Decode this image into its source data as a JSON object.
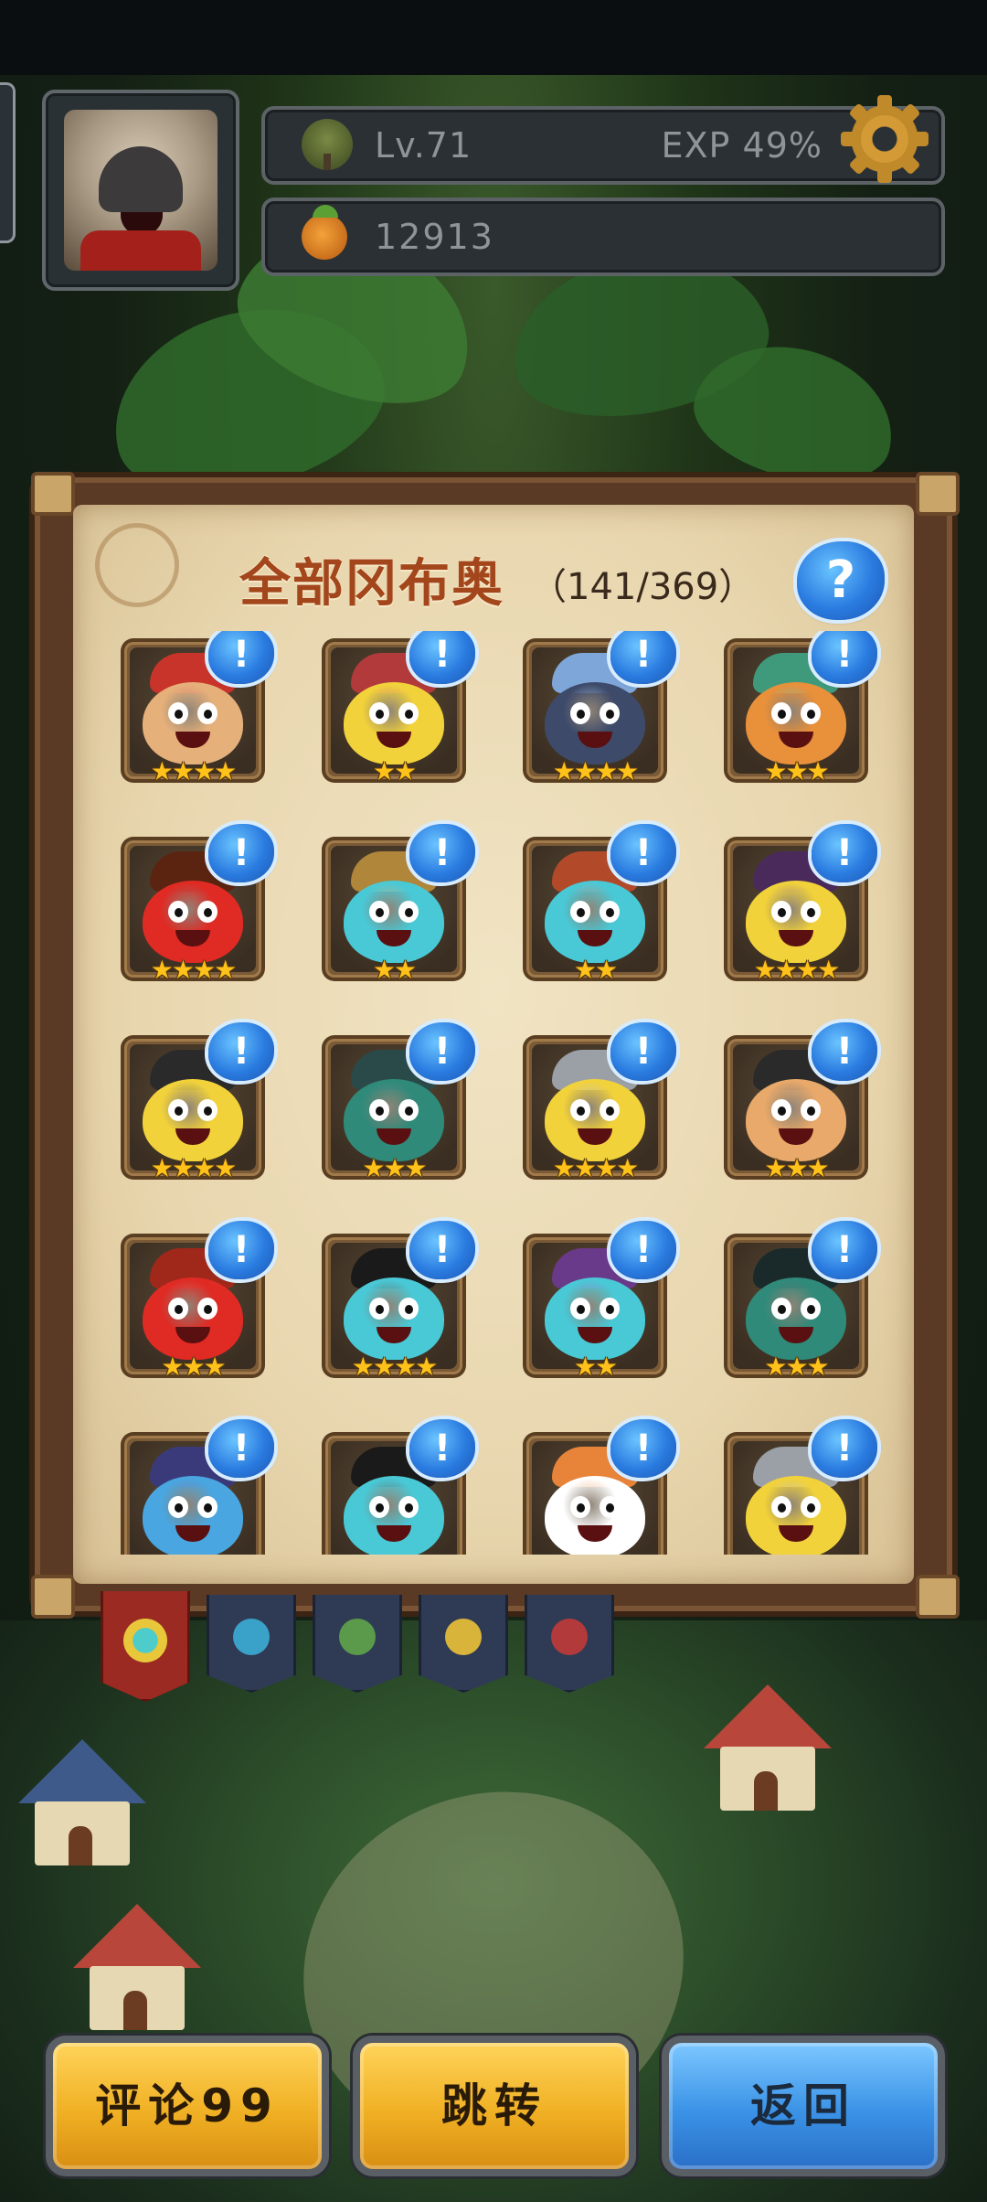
{
  "hud": {
    "level": "Lv.71",
    "exp": "EXP 49%",
    "gold": "12913"
  },
  "panel": {
    "title": "全部冈布奥",
    "count": "（141/369）",
    "help_symbol": "?"
  },
  "cards": [
    {
      "stars": "★★★★",
      "badge": "!",
      "color": "#e6b07a",
      "hat": "#c8342a"
    },
    {
      "stars": "★★",
      "badge": "!",
      "color": "#f2d23a",
      "hat": "#b23a3a"
    },
    {
      "stars": "★★★★",
      "badge": "!",
      "color": "#3d4a6a",
      "hat": "#7fa6d9"
    },
    {
      "stars": "★★★",
      "badge": "!",
      "color": "#e8903a",
      "hat": "#3e9a7a"
    },
    {
      "stars": "★★★★",
      "badge": "!",
      "color": "#e02a24",
      "hat": "#5a2410"
    },
    {
      "stars": "★★",
      "badge": "!",
      "color": "#49c9d6",
      "hat": "#b0863a"
    },
    {
      "stars": "★★",
      "badge": "!",
      "color": "#49c9d6",
      "hat": "#b24a2a"
    },
    {
      "stars": "★★★★",
      "badge": "!",
      "color": "#f2d23a",
      "hat": "#4a2a5a"
    },
    {
      "stars": "★★★★",
      "badge": "!",
      "color": "#f2d23a",
      "hat": "#2a2a2a"
    },
    {
      "stars": "★★★",
      "badge": "!",
      "color": "#2f8a7a",
      "hat": "#2a4a4a"
    },
    {
      "stars": "★★★★",
      "badge": "!",
      "color": "#f2d23a",
      "hat": "#9aa0a6"
    },
    {
      "stars": "★★★",
      "badge": "!",
      "color": "#e8a96a",
      "hat": "#2a2a2a"
    },
    {
      "stars": "★★★",
      "badge": "!",
      "color": "#e02a24",
      "hat": "#a0281a"
    },
    {
      "stars": "★★★★",
      "badge": "!",
      "color": "#49c9d6",
      "hat": "#1a1a1a"
    },
    {
      "stars": "★★",
      "badge": "!",
      "color": "#49c9d6",
      "hat": "#6a3a8a"
    },
    {
      "stars": "★★★",
      "badge": "!",
      "color": "#2f8a7a",
      "hat": "#1a2a2a"
    },
    {
      "stars": "",
      "badge": "!",
      "color": "#49a6e0",
      "hat": "#3a3a7a"
    },
    {
      "stars": "",
      "badge": "!",
      "color": "#49c9d6",
      "hat": "#1a1a1a"
    },
    {
      "stars": "",
      "badge": "!",
      "color": "#ffffff",
      "hat": "#e8843a"
    },
    {
      "stars": "",
      "badge": "!",
      "color": "#f2d23a",
      "hat": "#9aa0a6"
    }
  ],
  "buttons": {
    "comment": "评论99",
    "jump": "跳转",
    "back": "返回"
  },
  "colors": {
    "gold_button": "#f0b024",
    "blue_button": "#3a92e6",
    "badge_blue": "#2a7be0",
    "star": "#ffc21a",
    "title": "#a3461c"
  }
}
